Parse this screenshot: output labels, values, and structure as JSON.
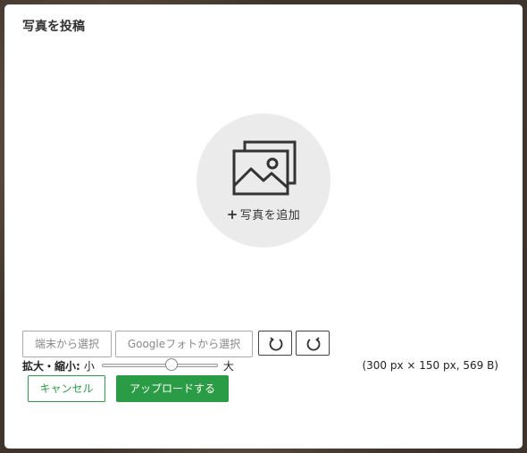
{
  "dialog": {
    "title": "写真を投稿"
  },
  "dropzone": {
    "plus_symbol": "+",
    "label": "写真を追加",
    "icon": "photos-icon"
  },
  "controls": {
    "select_device_label": "端末から選択",
    "select_google_photos_label": "Googleフォトから選択",
    "rotate_left_icon": "rotate-left-icon",
    "rotate_right_icon": "rotate-right-icon"
  },
  "zoom": {
    "label": "拡大・縮小:",
    "min_label": "小",
    "max_label": "大",
    "value_fraction": 0.6
  },
  "image_info": "(300 px × 150 px, 569 B)",
  "actions": {
    "cancel_label": "キャンセル",
    "upload_label": "アップロードする"
  },
  "colors": {
    "accent": "#2a9c45",
    "dropzone_bg": "#ebebeb"
  }
}
